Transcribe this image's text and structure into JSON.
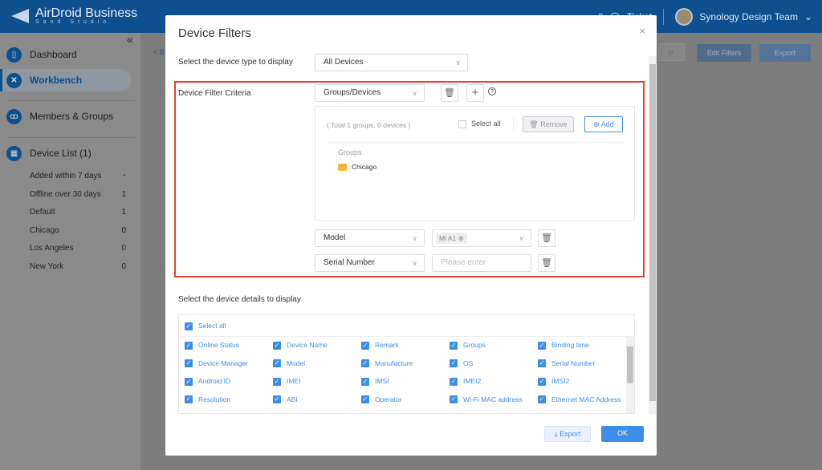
{
  "header": {
    "logo": "AirDroid Business",
    "logo_sub": "Sand Studio",
    "ticket": "Ticket",
    "user": "Synology Design Team"
  },
  "sidebar": {
    "items": [
      {
        "label": "Dashboard"
      },
      {
        "label": "Workbench"
      },
      {
        "label": "Members & Groups"
      },
      {
        "label": "Device List (1)"
      }
    ],
    "groups": [
      {
        "label": "Added within 7 days",
        "count": ""
      },
      {
        "label": "Offline over 30 days",
        "count": "1"
      },
      {
        "label": "Default",
        "count": "1"
      },
      {
        "label": "Chicago",
        "count": "0"
      },
      {
        "label": "Los Angeles",
        "count": "0"
      },
      {
        "label": "New York",
        "count": "0"
      }
    ]
  },
  "background": {
    "back": "< B",
    "edit_filters": "Edit Filters",
    "export": "Export"
  },
  "modal": {
    "title": "Device Filters",
    "close": "×",
    "device_type_label": "Select the device type to display",
    "device_type_value": "All Devices",
    "criteria_label": "Device Filter Criteria",
    "criteria_select": "Groups/Devices",
    "total": "( Total 1 groups, 0 devices )",
    "select_all": "Select all",
    "remove": "Remove",
    "add": "Add",
    "groups_heading": "Groups",
    "group_item": "Chicago",
    "model_select": "Model",
    "model_tag": "Mi A1",
    "serial_select": "Serial Number",
    "serial_placeholder": "Please enter",
    "details_label": "Select the device details to display",
    "details_select_all": "Select all",
    "details": [
      "Online Status",
      "Device Name",
      "Remark",
      "Groups",
      "Binding time",
      "Device Manager",
      "Model",
      "Manufacture",
      "OS",
      "Serial Number",
      "Android ID",
      "IMEI",
      "IMSI",
      "IMEI2",
      "IMSI2",
      "Resolution",
      "ABI",
      "Operator",
      "Wi-Fi MAC address",
      "Ethernet MAC Address"
    ],
    "export": "Export",
    "ok": "OK"
  },
  "colors": {
    "accent": "#3d8ee8",
    "highlight": "#e8402f",
    "header": "#0d4f8f"
  }
}
